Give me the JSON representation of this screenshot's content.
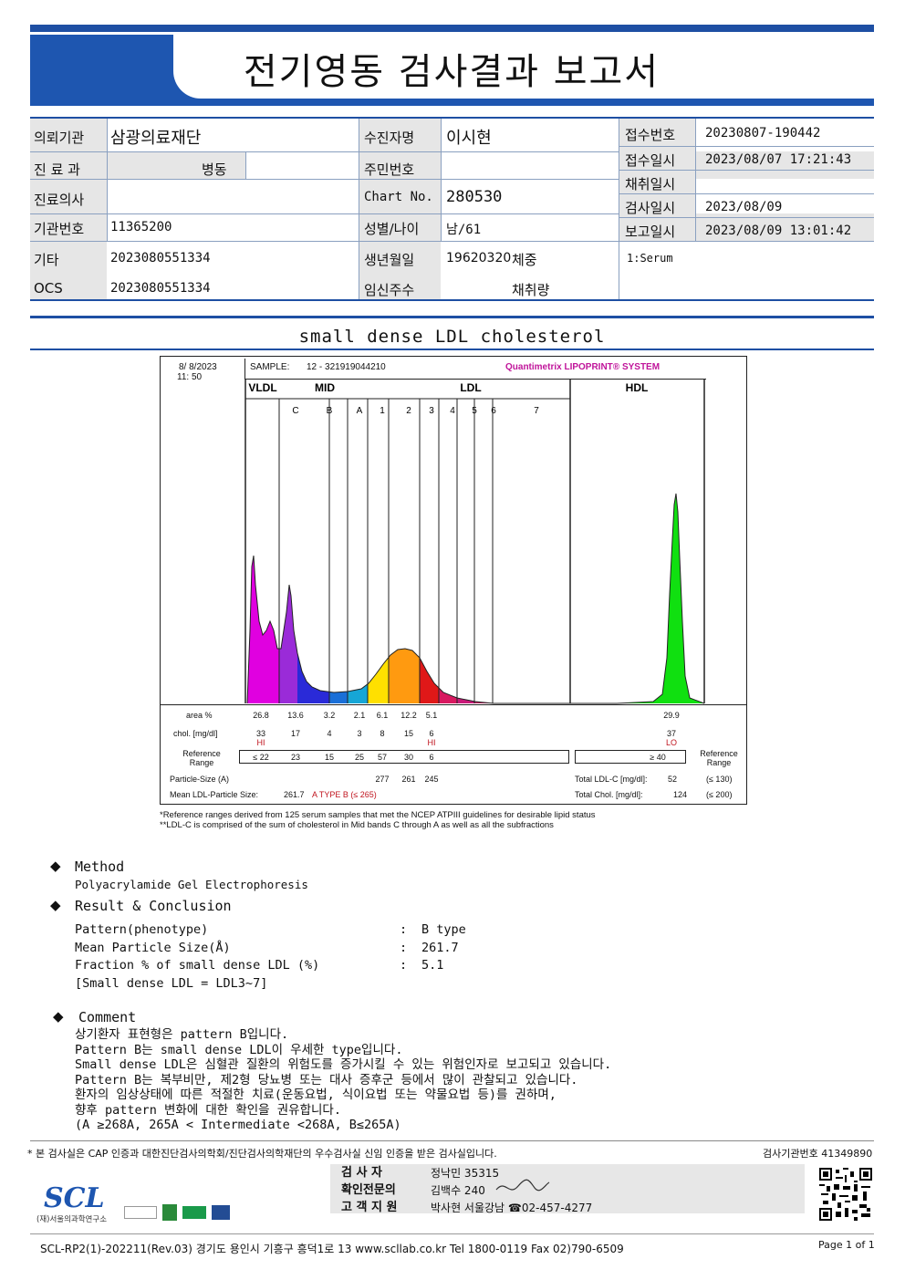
{
  "title": "전기영동 검사결과 보고서",
  "info": {
    "institution_label": "의뢰기관",
    "institution": "삼광의료재단",
    "dept_label": "진 료 과",
    "dept": "병동",
    "doctor_label": "진료의사",
    "inst_no_label": "기관번호",
    "inst_no": "11365200",
    "etc_label": "기타",
    "etc": "2023080551334",
    "ocs_label": "OCS",
    "ocs": "2023080551334",
    "patient_label": "수진자명",
    "patient": "이시현",
    "rrn_label": "주민번호",
    "chart_label": "Chart No.",
    "chart_no": "280530",
    "sexage_label": "성별/나이",
    "sexage": "남/61",
    "dob_label": "생년월일",
    "dob": "19620320",
    "weight_label": "체중",
    "preg_label": "임신주수",
    "amount_label": "채취량",
    "receipt_no_label": "접수번호",
    "receipt_no": "20230807-190442",
    "receipt_dt_label": "접수일시",
    "receipt_dt": "2023/08/07 17:21:43",
    "collect_label": "채취일시",
    "test_dt_label": "검사일시",
    "test_dt": "2023/08/09",
    "report_dt_label": "보고일시",
    "report_dt": "2023/08/09 13:01:42",
    "specimen": "1:Serum"
  },
  "section_title": "small dense LDL cholesterol",
  "chart_header": {
    "date": "8/  8/2023",
    "time": "11: 50",
    "sample_label": "SAMPLE:",
    "sample": "12 - 321919044210",
    "brand": "Quantimetrix LIPOPRINT® SYSTEM"
  },
  "chart_data": {
    "type": "area",
    "band_groups": [
      "VLDL",
      "MID",
      "LDL",
      "HDL"
    ],
    "bands": [
      "C",
      "B",
      "A",
      "1",
      "2",
      "3",
      "4",
      "5",
      "6",
      "7"
    ],
    "table_rows": {
      "area_label": "area %",
      "area": [
        "26.8",
        "13.6",
        "3.2",
        "2.1",
        "6.1",
        "12.2",
        "5.1",
        "29.9"
      ],
      "chol_label": "chol. [mg/dl]",
      "chol": [
        "33",
        "17",
        "4",
        "3",
        "8",
        "15",
        "6",
        "37"
      ],
      "flags": [
        "HI",
        "",
        "",
        "",
        "",
        "",
        "HI",
        "LO"
      ],
      "ref_label": "Reference Range",
      "ref": [
        "≤ 22",
        "23",
        "15",
        "25",
        "57",
        "30",
        "6",
        "≥ 40"
      ],
      "ref_right_label": "Reference Range",
      "particle_label": "Particle-Size (A)",
      "particle": [
        "277",
        "261",
        "245"
      ],
      "mean_label": "Mean LDL-Particle Size:",
      "mean": "261.7",
      "mean_note": "A TYPE B (≤ 265)",
      "total_ldl_label": "Total LDL-C [mg/dl]:",
      "total_ldl": "52",
      "total_ldl_ref": "(≤ 130)",
      "total_chol_label": "Total Chol. [mg/dl]:",
      "total_chol": "124",
      "total_chol_ref": "(≤ 200)"
    }
  },
  "footnotes": [
    "*Reference ranges derived from 125 serum samples that met the NCEP ATPIII guidelines for desirable lipid status",
    "**LDL-C is comprised of the sum of cholesterol in Mid bands C through A as well as all the subfractions"
  ],
  "method": {
    "title": "Method",
    "text": "Polyacrylamide Gel Electrophoresis"
  },
  "result": {
    "title": "Result & Conclusion",
    "rows": [
      {
        "label": "Pattern(phenotype)",
        "value": "B type"
      },
      {
        "label": "Mean Particle Size(Å)",
        "value": "261.7"
      },
      {
        "label": "Fraction % of small dense LDL (%)",
        "value": "5.1"
      }
    ],
    "note": "[Small dense LDL = LDL3~7]"
  },
  "comment": {
    "title": "Comment",
    "lines": [
      "상기환자 표현형은 pattern B입니다.",
      "Pattern B는 small dense LDL이 우세한 type입니다.",
      "Small dense LDL은 심혈관 질환의 위험도를 증가시킬 수 있는 위험인자로 보고되고 있습니다.",
      "Pattern B는 복부비만, 제2형 당뇨병 또는 대사 증후군 등에서 많이 관찰되고 있습니다.",
      "환자의 임상상태에 따른 적절한 치료(운동요법, 식이요법 또는 약물요법 등)를 권하며,",
      "향후 pattern 변화에 대한 확인을 권유합니다.",
      "(A ≥268A, 265A < Intermediate <268A, B≤265A)"
    ]
  },
  "footer": {
    "cert_note": "* 본 검사실은 CAP 인증과 대한진단검사의학회/진단검사의학재단의 우수검사실 신임 인증을 받은 검사실입니다.",
    "lab_no": "검사기관번호 41349890",
    "tester_label": "검 사 자",
    "tester": "정낙민 35315",
    "confirm_label": "확인전문의",
    "confirm": "김백수 240",
    "contact_label": "고 객 지 원",
    "contact": "박사현 서울강남 ☎02-457-4277",
    "logo_text": "SCL",
    "logo_sub": "(재)서울의과학연구소",
    "bottom_line": "SCL-RP2(1)-202211(Rev.03)  경기도 용인시 기흥구 흥덕1로 13  www.scllab.co.kr   Tel 1800-0119   Fax 02)790-6509",
    "page": "Page 1 of 1"
  }
}
